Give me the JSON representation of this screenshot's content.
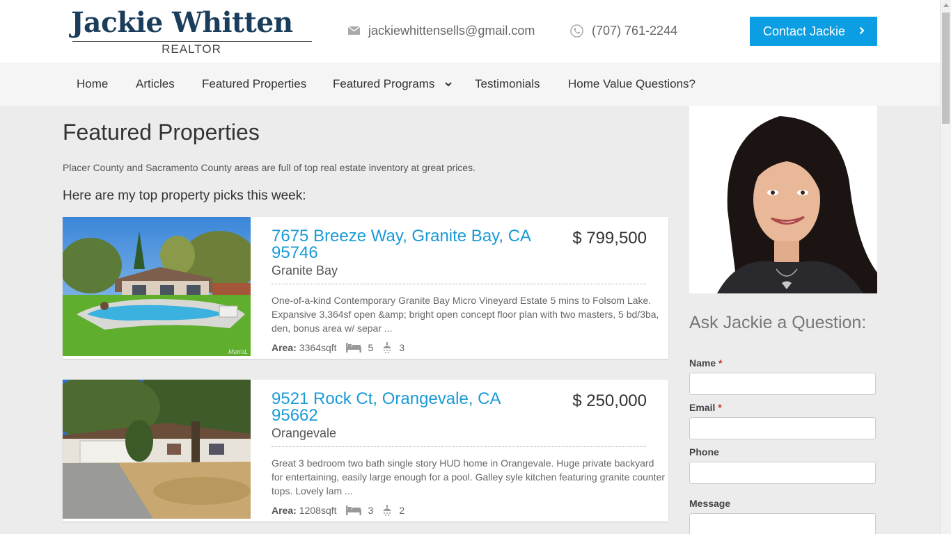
{
  "header": {
    "logo_name": "Jackie Whitten",
    "logo_sub": "REALTOR",
    "email": "jackiewhittensells@gmail.com",
    "phone": "(707) 761-2244",
    "contact_button": "Contact Jackie"
  },
  "nav": {
    "items": [
      {
        "label": "Home"
      },
      {
        "label": "Articles"
      },
      {
        "label": "Featured Properties"
      },
      {
        "label": "Featured Programs"
      },
      {
        "label": "Testimonials"
      },
      {
        "label": "Home Value Questions?"
      }
    ]
  },
  "main": {
    "title": "Featured Properties",
    "intro": "Placer County and Sacramento County areas are full of top real estate inventory at great prices.",
    "picks_heading": "Here are my top property picks this week:",
    "area_label": "Area:",
    "listings": [
      {
        "address": "7675 Breeze Way, Granite Bay, CA 95746",
        "price": "$ 799,500",
        "city": "Granite Bay",
        "description": "One-of-a-kind Contemporary Granite Bay Micro Vineyard Estate 5 mins to Folsom Lake. Expansive 3,364sf open &amp; bright open concept floor plan with two masters, 5 bd/3ba, den, bonus area w/ separ ...",
        "area": "3364sqft",
        "beds": "5",
        "baths": "3",
        "photo_watermark": "MetroL"
      },
      {
        "address": "9521 Rock Ct, Orangevale, CA 95662",
        "price": "$ 250,000",
        "city": "Orangevale",
        "description": "Great 3 bedroom two bath single story HUD home in Orangevale. Huge private backyard for entertaining, easily large enough for a pool. Galley syle kitchen featuring granite counter tops. Lovely lam ...",
        "area": "1208sqft",
        "beds": "3",
        "baths": "2"
      }
    ]
  },
  "sidebar": {
    "question_title": "Ask Jackie a Question:",
    "name_label": "Name",
    "email_label": "Email",
    "phone_label": "Phone",
    "message_label": "Message",
    "required_mark": "*"
  },
  "icons": {
    "email": "envelope-icon",
    "phone": "phone-icon",
    "contact_arrow": "chevron-right-icon",
    "dropdown": "chevron-down-icon",
    "beds": "bed-icon",
    "baths": "shower-icon"
  },
  "colors": {
    "accent": "#0c9ee2",
    "link": "#1a9ad6",
    "logo": "#1a3d5c",
    "required": "#c0392b"
  }
}
